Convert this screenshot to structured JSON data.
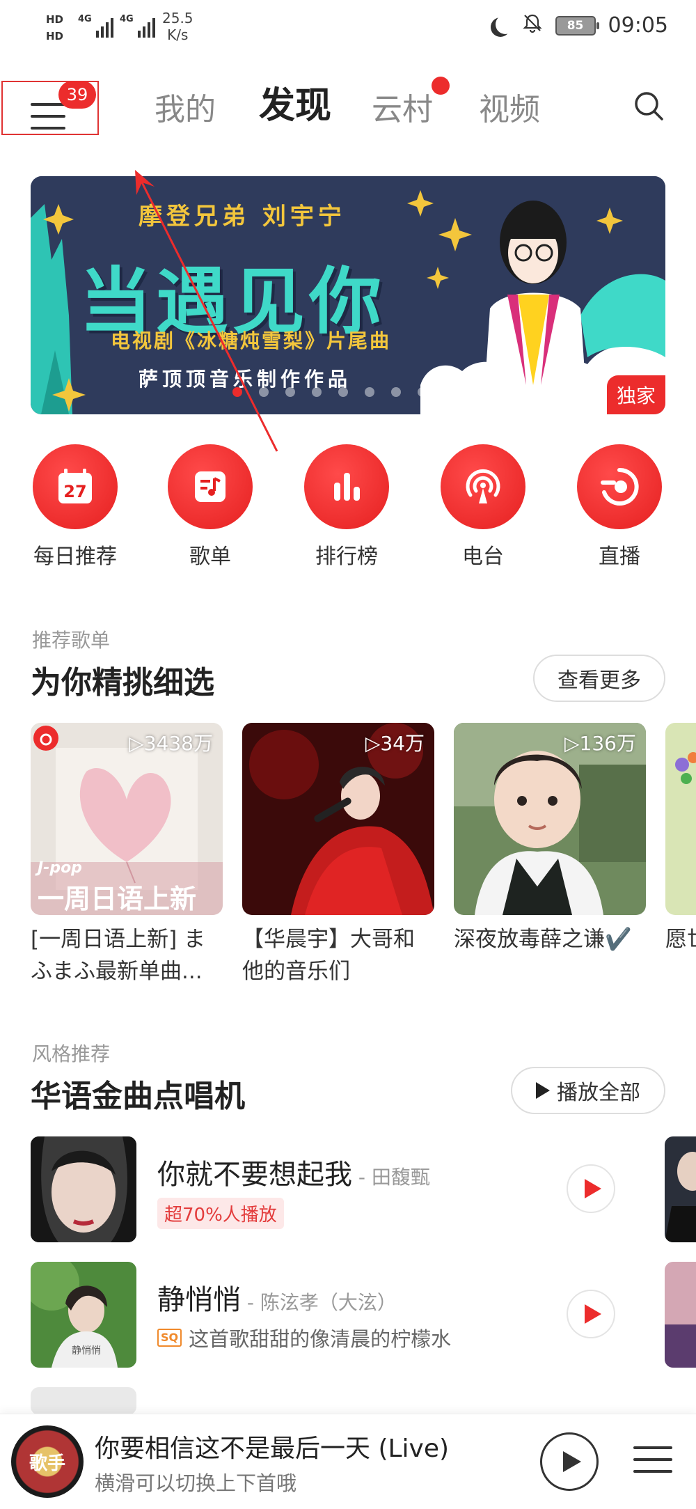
{
  "status_bar": {
    "hd1": "HD",
    "hd2": "HD",
    "network1": "4G",
    "network2": "4G",
    "speed_value": "25.5",
    "speed_unit": "K/s",
    "battery": "85",
    "time": "09:05"
  },
  "nav": {
    "menu_badge": "39",
    "tabs": [
      "我的",
      "发现",
      "云村",
      "视频"
    ],
    "active_tab": "发现"
  },
  "banner": {
    "line1": "摩登兄弟 刘宇宁",
    "headline": "当遇见你",
    "line3": "电视剧《冰糖炖雪梨》片尾曲",
    "line4": "萨顶顶音乐制作作品",
    "tag": "独家",
    "dot_count": 9,
    "active_dot": 0
  },
  "quick_entries": [
    {
      "label": "每日推荐",
      "icon": "calendar-icon",
      "day": "27"
    },
    {
      "label": "歌单",
      "icon": "playlist-icon"
    },
    {
      "label": "排行榜",
      "icon": "chart-bars-icon"
    },
    {
      "label": "电台",
      "icon": "radio-icon"
    },
    {
      "label": "直播",
      "icon": "live-icon"
    }
  ],
  "recommend": {
    "small_title": "推荐歌单",
    "title": "为你精挑细选",
    "more": "查看更多",
    "playlists": [
      {
        "count": "▷3438万",
        "title": "[一周日语上新] まふまふ最新单曲...",
        "cover_text_small": "J-pop",
        "cover_text": "一周日语上新"
      },
      {
        "count": "▷34万",
        "title": "【华晨宇】大哥和他的音乐们"
      },
      {
        "count": "▷136万",
        "title": "深夜放毒薛之谦✔️"
      },
      {
        "count": "",
        "title": "愿世环樹"
      }
    ]
  },
  "style": {
    "small_title": "风格推荐",
    "title": "华语金曲点唱机",
    "play_all": "播放全部",
    "songs": [
      {
        "name": "你就不要想起我",
        "artist": " - 田馥甄",
        "tag": "超70%人播放"
      },
      {
        "name": "静悄悄",
        "artist": " - 陈泫孝（大泫）",
        "badge": "SQ",
        "desc": "这首歌甜甜的像清晨的柠檬水"
      }
    ]
  },
  "player": {
    "title": "你要相信这不是最后一天 (Live)",
    "subtitle": "横滑可以切换上下首哦",
    "disc_text": "歌手"
  },
  "colors": {
    "accent": "#ec2c2c",
    "banner_bg": "#2f3b5c",
    "banner_teal": "#3fd9c8",
    "banner_gold": "#f3c63c"
  }
}
